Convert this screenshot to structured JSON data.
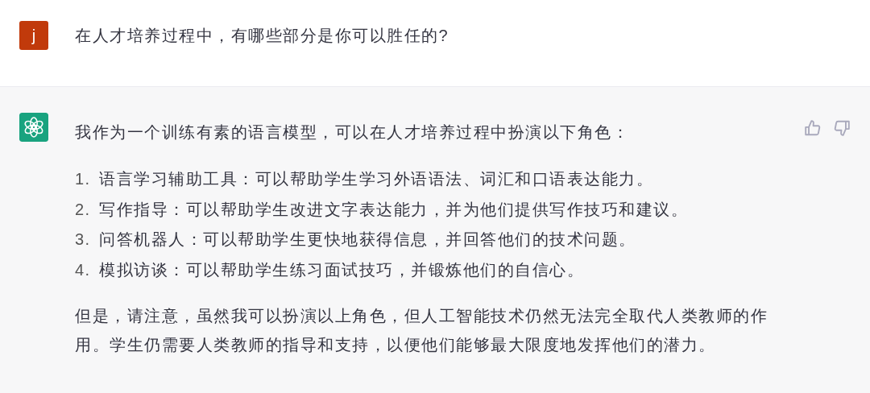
{
  "messages": [
    {
      "kind": "user",
      "avatar": "j",
      "text": "在人才培养过程中，有哪些部分是你可以胜任的?"
    },
    {
      "kind": "assistant",
      "intro": "我作为一个训练有素的语言模型，可以在人才培养过程中扮演以下角色：",
      "list": [
        {
          "number": "1.",
          "text": "语言学习辅助工具：可以帮助学生学习外语语法、词汇和口语表达能力。"
        },
        {
          "number": "2.",
          "text": "写作指导：可以帮助学生改进文字表达能力，并为他们提供写作技巧和建议。"
        },
        {
          "number": "3.",
          "text": "问答机器人：可以帮助学生更快地获得信息，并回答他们的技术问题。"
        },
        {
          "number": "4.",
          "text": "模拟访谈：可以帮助学生练习面试技巧，并锻炼他们的自信心。"
        }
      ],
      "closing": "但是，请注意，虽然我可以扮演以上角色，但人工智能技术仍然无法完全取代人类教师的作用。学生仍需要人类教师的指导和支持，以便他们能够最大限度地发挥他们的潜力。"
    }
  ]
}
